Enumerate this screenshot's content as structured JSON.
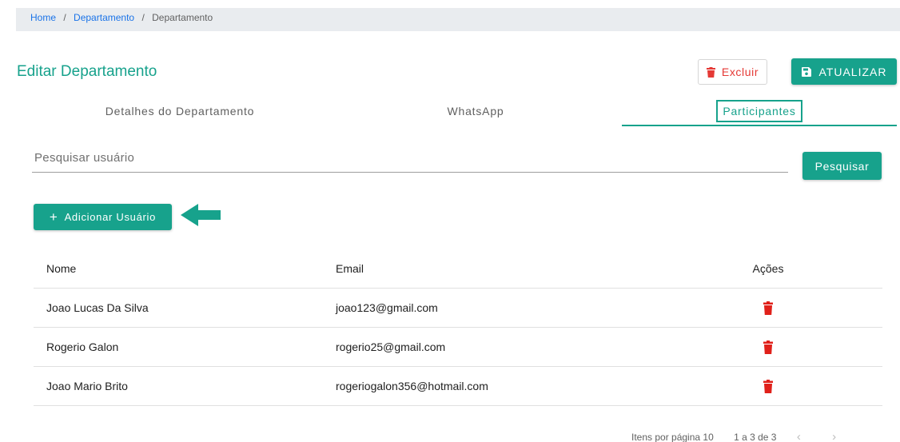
{
  "breadcrumb": {
    "home": "Home",
    "parent": "Departamento",
    "current": "Departamento",
    "separator": "/"
  },
  "page_title": "Editar Departamento",
  "actions": {
    "delete_label": "Excluir",
    "update_label": "ATUALIZAR"
  },
  "tabs": [
    {
      "label": "Detalhes do Departamento"
    },
    {
      "label": "WhatsApp"
    },
    {
      "label": "Participantes"
    }
  ],
  "search": {
    "placeholder": "Pesquisar usuário",
    "value": "",
    "button_label": "Pesquisar"
  },
  "add_user_label": "Adicionar Usuário",
  "table": {
    "columns": [
      "Nome",
      "Email",
      "Ações"
    ],
    "rows": [
      {
        "name": "Joao Lucas Da Silva",
        "email": "joao123@gmail.com"
      },
      {
        "name": "Rogerio Galon",
        "email": "rogerio25@gmail.com"
      },
      {
        "name": "Joao Mario Brito",
        "email": "rogeriogalon356@hotmail.com"
      }
    ]
  },
  "pagination": {
    "items_per_page": "Itens por página 10",
    "range": "1 a 3 de 3",
    "prev_icon": "chevron-left-icon",
    "next_icon": "chevron-right-icon"
  },
  "colors": {
    "accent": "#17a28c",
    "danger": "#e53935",
    "link": "#1a73e8"
  }
}
